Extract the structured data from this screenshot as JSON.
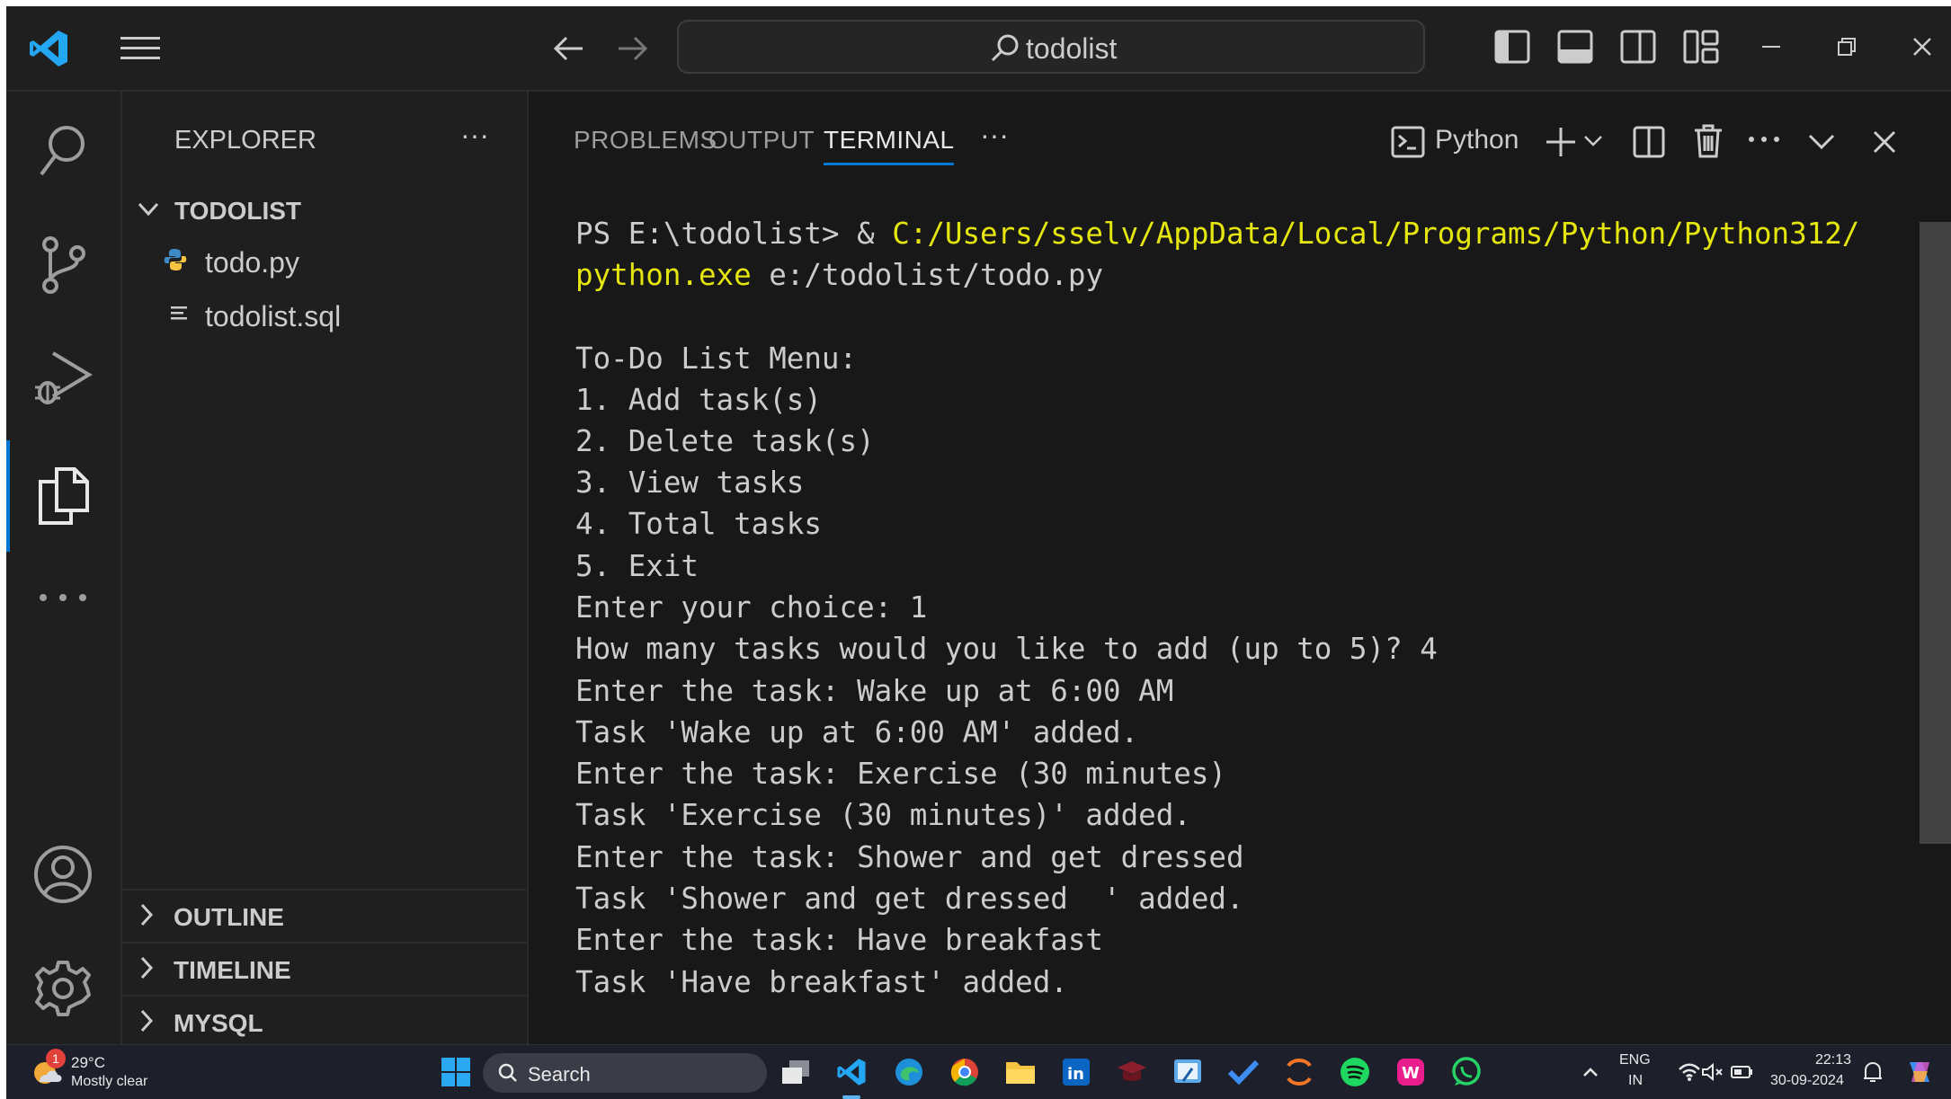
{
  "titlebar": {
    "search_text": "todolist"
  },
  "activity_bar": {
    "icons": [
      "search-icon",
      "source-control-icon",
      "run-debug-icon",
      "explorer-icon",
      "more-icon",
      "account-icon",
      "gear-icon"
    ]
  },
  "explorer": {
    "title": "EXPLORER",
    "more": "···",
    "folder": "TODOLIST",
    "files": [
      {
        "name": "todo.py",
        "icon": "python-file-icon"
      },
      {
        "name": "todolist.sql",
        "icon": "sql-file-icon"
      }
    ],
    "sections": [
      "OUTLINE",
      "TIMELINE",
      "MYSQL"
    ]
  },
  "panel": {
    "tabs": [
      "PROBLEMS",
      "OUTPUT",
      "TERMINAL"
    ],
    "active_tab": "TERMINAL",
    "more": "···",
    "shell_label": "Python",
    "terminal": {
      "prompt_prefix": "PS E:\\todolist> & ",
      "python_path": "C:/Users/sselv/AppData/Local/Programs/Python/Python312/",
      "line2_path": "python.exe",
      "line2_rest": " e:/todolist/todo.py",
      "output_lines": [
        "To-Do List Menu:",
        "1. Add task(s)",
        "2. Delete task(s)",
        "3. View tasks",
        "4. Total tasks",
        "5. Exit",
        "Enter your choice: 1",
        "How many tasks would you like to add (up to 5)? 4",
        "Enter the task: Wake up at 6:00 AM",
        "Task 'Wake up at 6:00 AM' added.",
        "Enter the task: Exercise (30 minutes)",
        "Task 'Exercise (30 minutes)' added.",
        "Enter the task: Shower and get dressed",
        "Task 'Shower and get dressed  ' added.",
        "Enter the task: Have breakfast",
        "Task 'Have breakfast' added."
      ]
    }
  },
  "taskbar": {
    "weather_temp": "29°C",
    "weather_desc": "Mostly clear",
    "weather_badge": "1",
    "search_label": "Search",
    "lang_top": "ENG",
    "lang_bottom": "IN",
    "time": "22:13",
    "date": "30-09-2024",
    "colors": {
      "accent": "#0078d4",
      "terminal_yellow": "#e5e510"
    }
  }
}
